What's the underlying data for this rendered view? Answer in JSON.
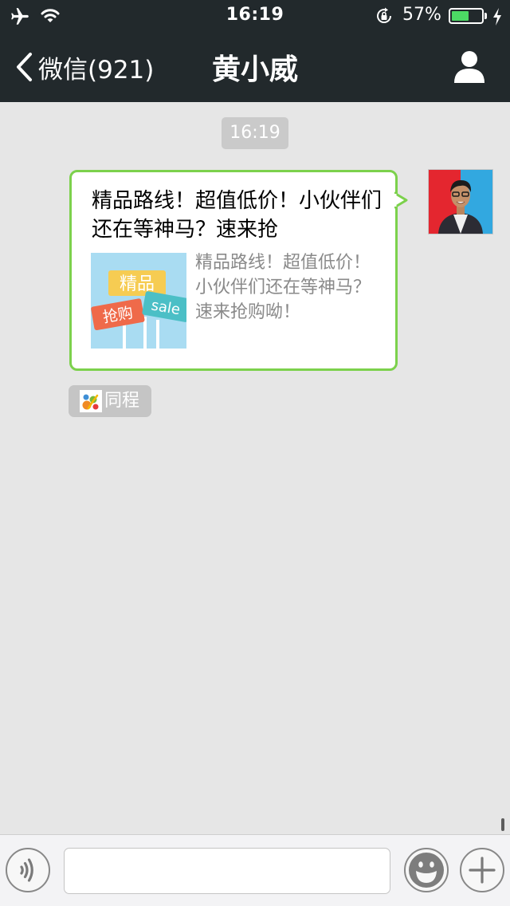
{
  "status_bar": {
    "time": "16:19",
    "battery_percent_label": "57%",
    "battery_level": 0.57,
    "icons": [
      "airplane-icon",
      "wifi-icon",
      "rotation-lock-icon",
      "battery-icon",
      "charging-bolt-icon"
    ]
  },
  "nav": {
    "back_label": "微信(921)",
    "title": "黄小威",
    "back_icon": "chevron-left-icon",
    "profile_icon": "person-icon"
  },
  "chat": {
    "timestamp": "16:19",
    "message": {
      "title": "精品路线！超值低价！小伙伴们还在等神马？速来抢",
      "description": "精品路线！超值低价！小伙伴们还在等神马？速来抢购呦！",
      "thumbnail": {
        "sign_top": "精品",
        "sign_left": "抢购",
        "sign_right": "sale"
      }
    },
    "source_label": "同程",
    "source_icon": "tongcheng-logo-icon"
  },
  "input_bar": {
    "voice_icon": "voice-icon",
    "emoji_icon": "smiley-icon",
    "plus_icon": "plus-icon",
    "placeholder": ""
  },
  "colors": {
    "nav_background": "#22292c",
    "bubble_border": "#7cd14c",
    "chat_background": "#e6e6e6",
    "battery_fill": "#4cd964"
  }
}
